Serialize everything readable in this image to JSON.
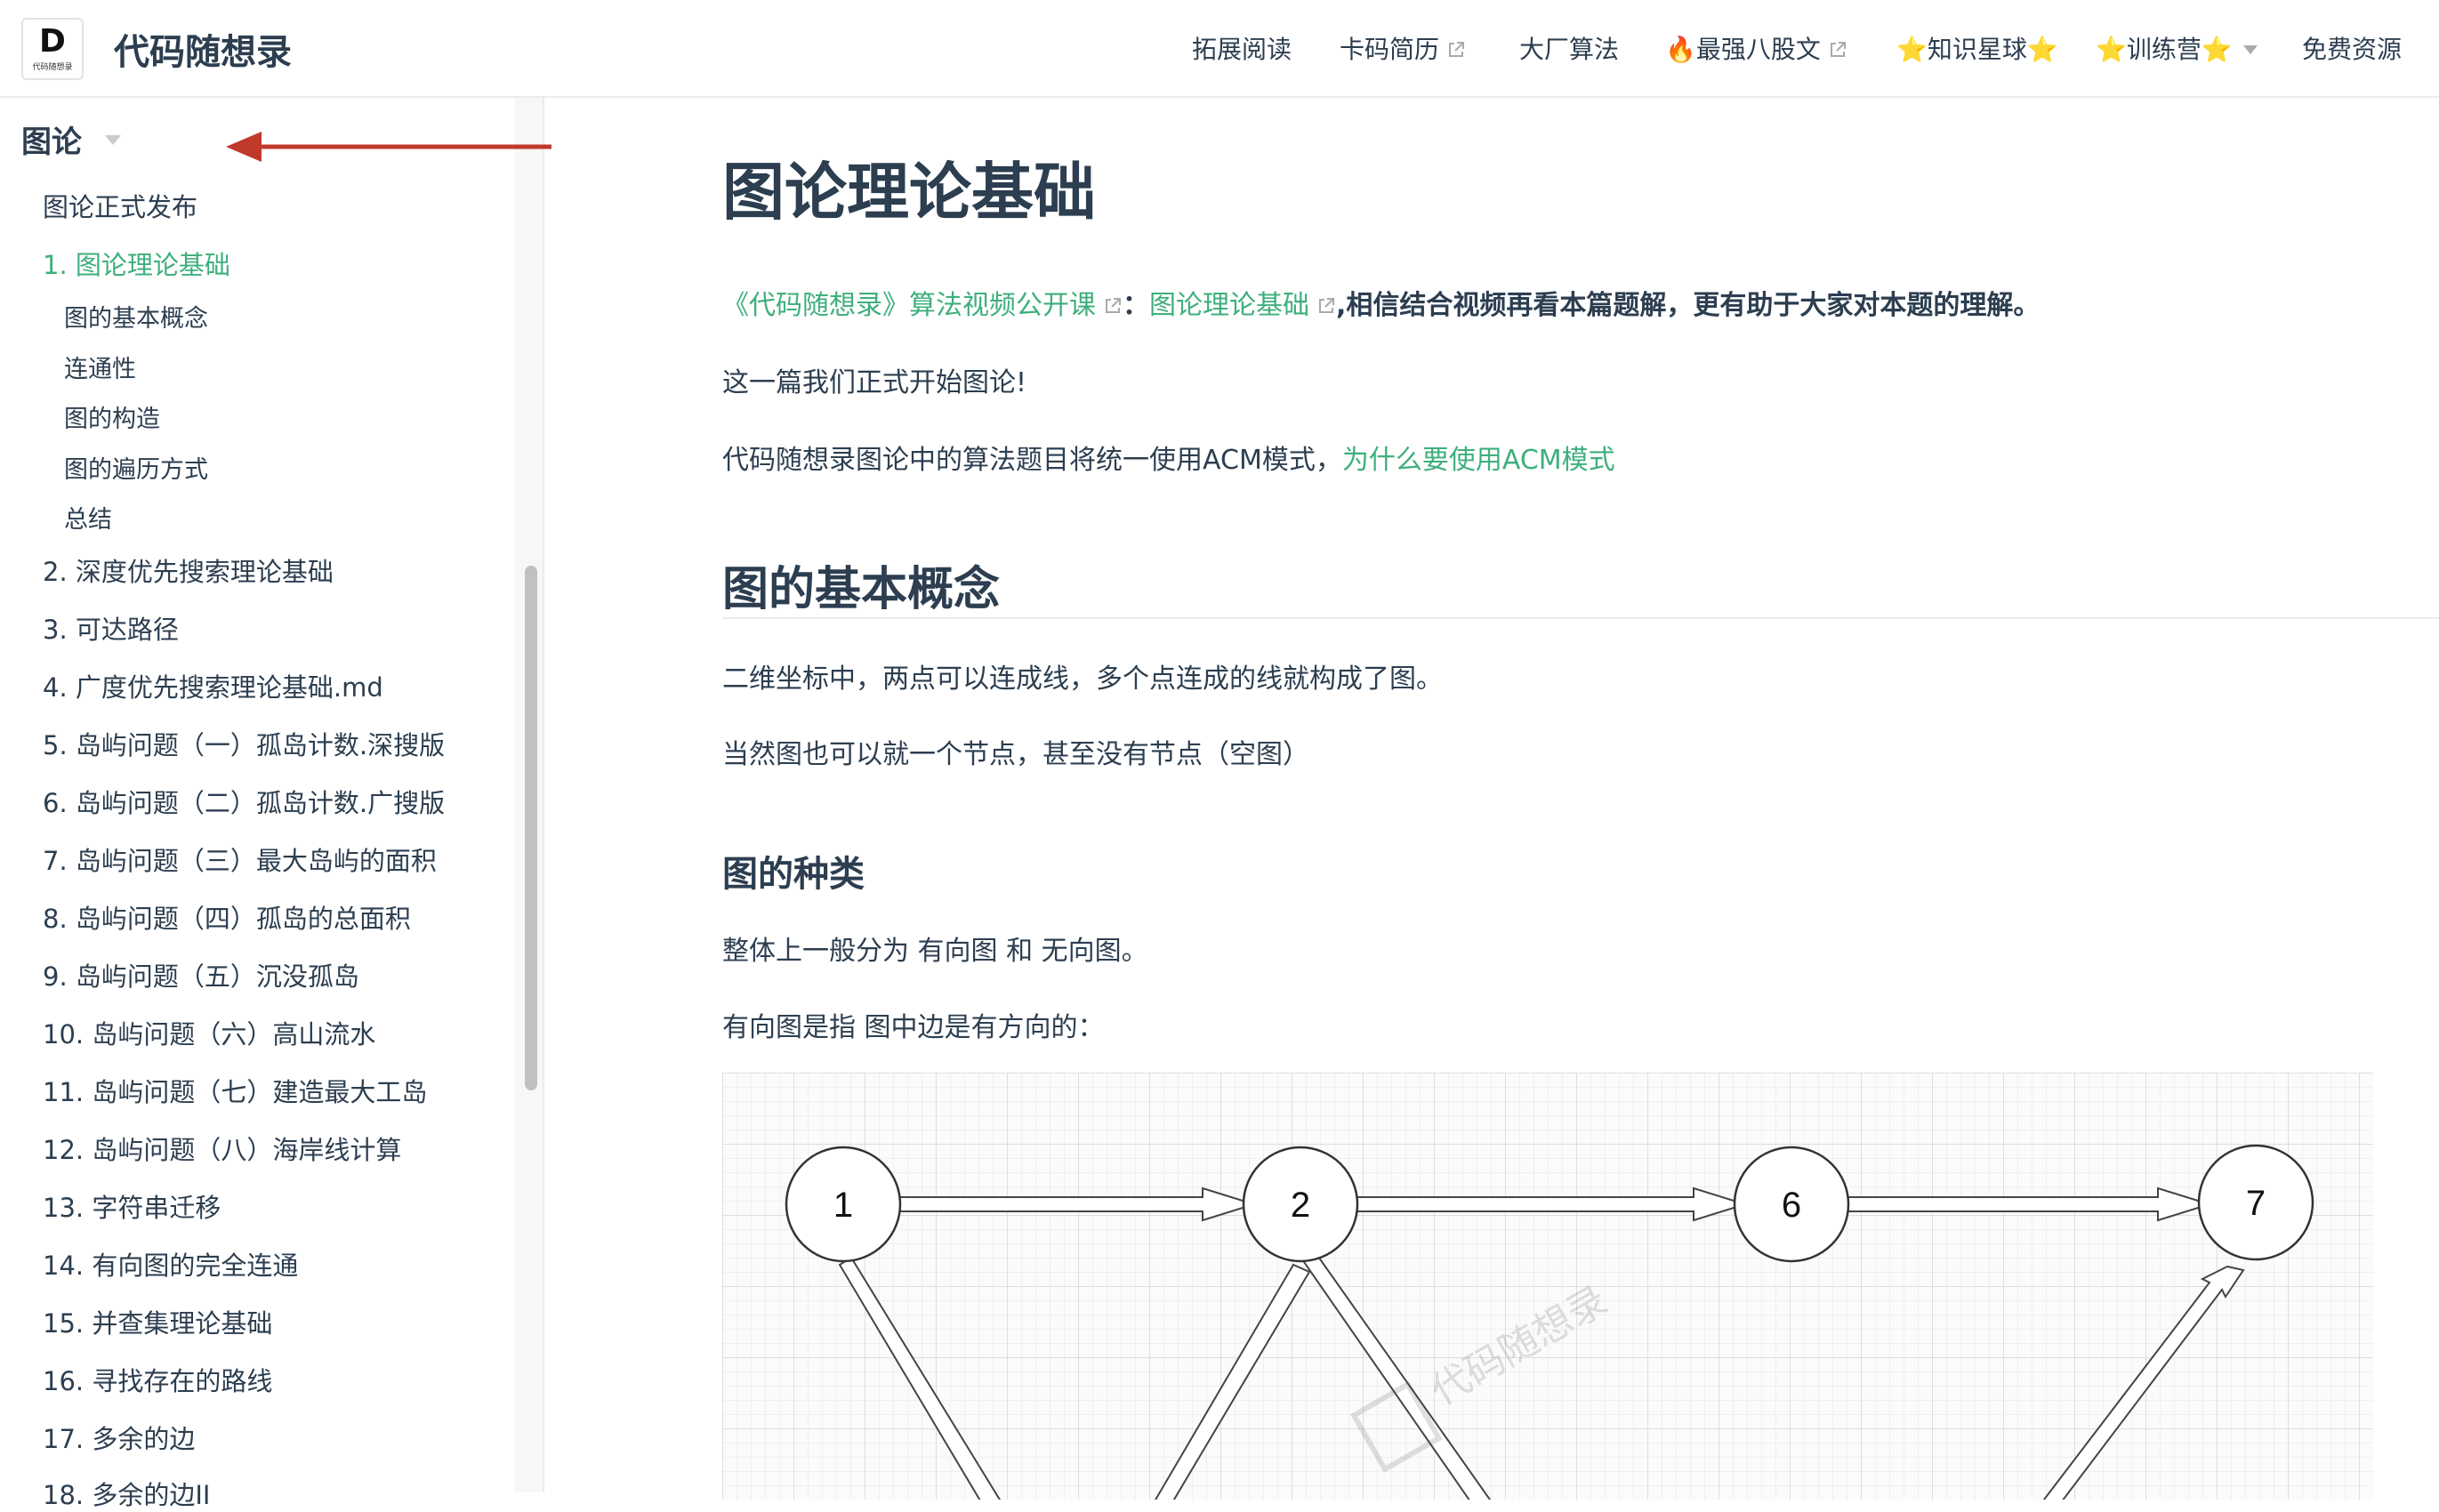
{
  "navbar": {
    "logo_letter": "D",
    "logo_sub": "代码随想录",
    "site_name": "代码随想录",
    "items": [
      {
        "label": "拓展阅读",
        "external": false,
        "dropdown": false
      },
      {
        "label": "卡码简历",
        "external": true,
        "dropdown": false
      },
      {
        "label": "大厂算法",
        "external": false,
        "dropdown": false
      },
      {
        "label": "🔥最强八股文",
        "external": true,
        "dropdown": false
      },
      {
        "label": "⭐知识星球⭐",
        "external": false,
        "dropdown": false
      },
      {
        "label": "⭐训练营⭐",
        "external": false,
        "dropdown": true
      },
      {
        "label": "免费资源",
        "external": false,
        "dropdown": false
      }
    ]
  },
  "sidebar": {
    "group_title": "图论",
    "items": [
      {
        "label": "图论正式发布"
      },
      {
        "label": "1. 图论理论基础",
        "active": true
      },
      {
        "label": "图的基本概念",
        "sub": true
      },
      {
        "label": "连通性",
        "sub": true
      },
      {
        "label": "图的构造",
        "sub": true
      },
      {
        "label": "图的遍历方式",
        "sub": true
      },
      {
        "label": "总结",
        "sub": true
      },
      {
        "label": "2. 深度优先搜索理论基础"
      },
      {
        "label": "3. 可达路径"
      },
      {
        "label": "4. 广度优先搜索理论基础.md"
      },
      {
        "label": "5. 岛屿问题（一）孤岛计数.深搜版"
      },
      {
        "label": "6. 岛屿问题（二）孤岛计数.广搜版"
      },
      {
        "label": "7. 岛屿问题（三）最大岛屿的面积"
      },
      {
        "label": "8. 岛屿问题（四）孤岛的总面积"
      },
      {
        "label": "9. 岛屿问题（五）沉没孤岛"
      },
      {
        "label": "10. 岛屿问题（六）高山流水"
      },
      {
        "label": "11. 岛屿问题（七）建造最大工岛"
      },
      {
        "label": "12. 岛屿问题（八）海岸线计算"
      },
      {
        "label": "13. 字符串迁移"
      },
      {
        "label": "14. 有向图的完全连通"
      },
      {
        "label": "15. 并查集理论基础"
      },
      {
        "label": "16. 寻找存在的路线"
      },
      {
        "label": "17. 多余的边"
      },
      {
        "label": "18. 多余的边II"
      }
    ]
  },
  "content": {
    "title": "图论理论基础",
    "video_link": "《代码随想录》算法视频公开课",
    "video_sep": "：",
    "video_topic": "图论理论基础",
    "video_tail": ",相信结合视频再看本篇题解，更有助于大家对本题的理解。",
    "intro": "这一篇我们正式开始图论!",
    "acm_text": "代码随想录图论中的算法题目将统一使用ACM模式，",
    "acm_link": "为什么要使用ACM模式",
    "section_title": "图的基本概念",
    "p1": "二维坐标中，两点可以连成线，多个点连成的线就构成了图。",
    "p2": "当然图也可以就一个节点，甚至没有节点（空图）",
    "subsection_title": "图的种类",
    "p3": "整体上一般分为 有向图 和 无向图。",
    "p4": "有向图是指 图中边是有方向的：",
    "graph_nodes": [
      "1",
      "2",
      "6",
      "7"
    ],
    "watermark": "代码随想录"
  },
  "colors": {
    "accent": "#3eaf7c",
    "text": "#2c3e50",
    "annotation": "#c0392b"
  }
}
